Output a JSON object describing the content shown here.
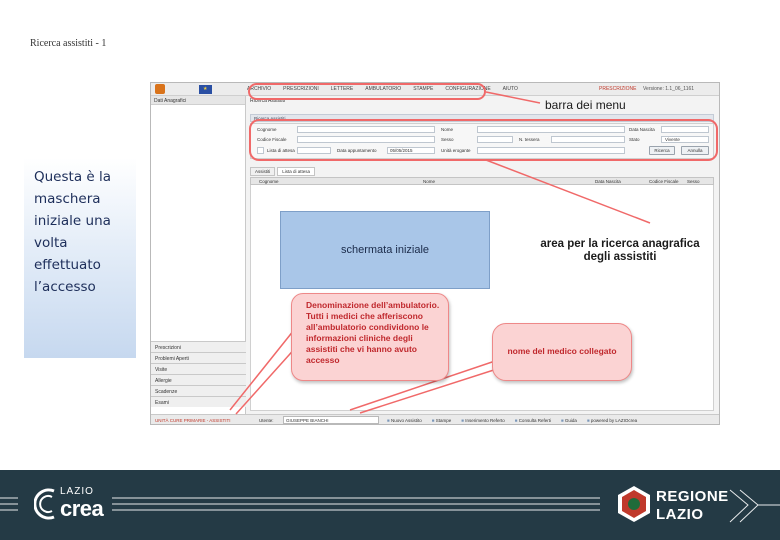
{
  "slide": {
    "title": "Ricerca assistiti - 1",
    "intro_text": "Questa è la maschera iniziale una volta effettuato l’accesso"
  },
  "app": {
    "menu_items": [
      "ARCHIVIO",
      "PRESCRIZIONI",
      "LETTERE",
      "AMBULATORIO",
      "STAMPE",
      "CONFIGURAZIONE",
      "AIUTO"
    ],
    "top_red_text": "PRESCRIZIONE",
    "top_right_text": "Versione: 1.1_06_1161",
    "sidebar": {
      "header": "Dati Anagrafici",
      "items": [
        "Prescrizioni",
        "Problemi Aperti",
        "Visite",
        "Allergie",
        "Scadenze",
        "Esami"
      ]
    },
    "breadcrumb": "Ricerca Assistiti",
    "search": {
      "header": "Ricerca Assistiti",
      "labels": {
        "cognome": "Cognome",
        "nome": "Nome",
        "data_nascita": "Data Nascita",
        "codice_fiscale": "Codice Fiscale",
        "sesso": "Sesso",
        "n_tessera": "N. tessera",
        "stato": "Stato",
        "lista_attesa": "Lista di attesa",
        "data_appuntamento": "Data appuntamento",
        "data_appuntamento_value": "05/05/2015",
        "unita_erogante": "Unità erogante"
      },
      "stato_value": "Vivente",
      "btn_search": "Ricerca",
      "btn_reset": "Annulla"
    },
    "result_tabs": [
      "Assistiti",
      "Lista di attesa"
    ],
    "grid_columns": [
      "Cognome",
      "Nome",
      "Data Nascita",
      "Codice Fiscale",
      "Sesso"
    ],
    "statusbar": {
      "red_text": "UNITÀ CURE PRIMARIE - ASSISTITI",
      "user_label": "Utente:",
      "user_value": "GIUSEPPE BIANCHI",
      "actions": [
        "Nuovo Assistito",
        "Stampe",
        "Inserimento Referto",
        "Consulta Referti",
        "Guida",
        "powered by LAZIOcrea"
      ]
    }
  },
  "annotations": {
    "barra_menu": "barra dei menu",
    "schermata_iniziale": "schermata iniziale",
    "area_ricerca": "area per la ricerca anagrafica degli assistiti",
    "callout_ambulatorio": "Denominazione dell’ambulatorio. Tutti i medici che afferiscono all’ambulatorio condividono le informazioni cliniche degli assistiti che vi hanno avuto accesso",
    "callout_medico": "nome del medico collegato"
  },
  "footer": {
    "left_logo_small": "LAZIO",
    "left_logo_big": "crea",
    "right_logo_line1": "REGIONE",
    "right_logo_line2": "LAZIO"
  },
  "colors": {
    "annotation_red": "#f06969",
    "callout_fill": "#fbd3d3",
    "footer_bg": "#243a45",
    "blue_box": "#a9c6e8"
  }
}
